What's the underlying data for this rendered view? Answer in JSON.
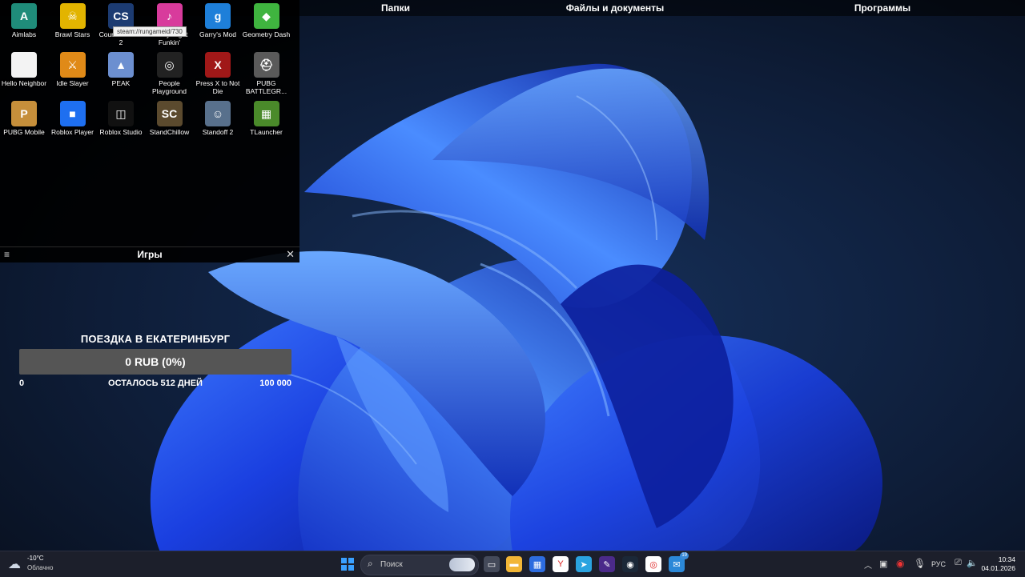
{
  "fences": {
    "top_titles": [
      "Папки",
      "Файлы и документы",
      "Программы"
    ],
    "games_title": "Игры"
  },
  "games": [
    {
      "label": "Aimlabs",
      "icon": "aimlabs-icon",
      "color": "#1f8c7a",
      "glyph": "A"
    },
    {
      "label": "Brawl Stars",
      "icon": "brawl-stars-icon",
      "color": "#e2b400",
      "glyph": "☠"
    },
    {
      "label": "Counter-Strike 2",
      "icon": "counter-strike-icon",
      "color": "#1c3b72",
      "glyph": "CS"
    },
    {
      "label": "Friday Night Funkin'",
      "icon": "fnf-icon",
      "color": "#d83b9c",
      "glyph": "♪"
    },
    {
      "label": "Garry's Mod",
      "icon": "garrys-mod-icon",
      "color": "#1e7fd9",
      "glyph": "g"
    },
    {
      "label": "Geometry Dash",
      "icon": "geometry-dash-icon",
      "color": "#3fb43f",
      "glyph": "◆"
    },
    {
      "label": "Hello Neighbor",
      "icon": "file-icon",
      "color": "#f3f3f3",
      "glyph": ""
    },
    {
      "label": "Idle Slayer",
      "icon": "idle-slayer-icon",
      "color": "#e08a18",
      "glyph": "⚔"
    },
    {
      "label": "PEAK",
      "icon": "peak-icon",
      "color": "#6c8fd0",
      "glyph": "▲"
    },
    {
      "label": "People Playground",
      "icon": "people-playground-icon",
      "color": "#222222",
      "glyph": "◎"
    },
    {
      "label": "Press X to Not Die",
      "icon": "press-x-icon",
      "color": "#a01818",
      "glyph": "X"
    },
    {
      "label": "PUBG BATTLEGR...",
      "icon": "pubg-icon",
      "color": "#5a5a5a",
      "glyph": "⛑"
    },
    {
      "label": "PUBG Mobile",
      "icon": "pubg-mobile-icon",
      "color": "#c68f3b",
      "glyph": "P"
    },
    {
      "label": "Roblox Player",
      "icon": "roblox-icon",
      "color": "#1e6ff0",
      "glyph": "■"
    },
    {
      "label": "Roblox Studio",
      "icon": "roblox-studio-icon",
      "color": "#111111",
      "glyph": "◫"
    },
    {
      "label": "StandChillow",
      "icon": "standchillow-icon",
      "color": "#5b4a2e",
      "glyph": "SC"
    },
    {
      "label": "Standoff 2",
      "icon": "standoff-icon",
      "color": "#58708c",
      "glyph": "☺"
    },
    {
      "label": "TLauncher",
      "icon": "tlauncher-icon",
      "color": "#4a8a2a",
      "glyph": "▦"
    }
  ],
  "tooltip": "steam://rungameid/730",
  "goal": {
    "title": "ПОЕЗДКА В ЕКАТЕРИНБУРГ",
    "progress_text": "0 RUB (0%)",
    "progress_fraction": 0,
    "min": "0",
    "max": "100 000",
    "remaining": "ОСТАЛОСЬ 512 ДНЕЙ"
  },
  "taskbar": {
    "weather_temp": "-10°C",
    "weather_condition": "Облачно",
    "search_placeholder": "Поиск",
    "language": "РУС",
    "time": "10:34",
    "date": "04.01.2026",
    "badge_count": "19",
    "pinned": [
      {
        "name": "start-icon",
        "color": "#3aa0ff",
        "glyph": "⊞"
      },
      {
        "name": "task-view-icon",
        "color": "#444a5a",
        "glyph": "▭"
      },
      {
        "name": "file-explorer-icon",
        "color": "#f2b636",
        "glyph": "▬"
      },
      {
        "name": "store-icon",
        "color": "#2d6cdf",
        "glyph": "▦"
      },
      {
        "name": "yandex-browser-icon",
        "color": "#ffffff",
        "glyph": "Y"
      },
      {
        "name": "telegram-icon",
        "color": "#2aa3e0",
        "glyph": "➤"
      },
      {
        "name": "feather-app-icon",
        "color": "#4b2a8a",
        "glyph": "✎"
      },
      {
        "name": "steam-icon",
        "color": "#1b2838",
        "glyph": "◉"
      },
      {
        "name": "chrome-icon",
        "color": "#ffffff",
        "glyph": "◎"
      },
      {
        "name": "messenger-icon",
        "color": "#2b88d8",
        "glyph": "✉"
      }
    ]
  }
}
